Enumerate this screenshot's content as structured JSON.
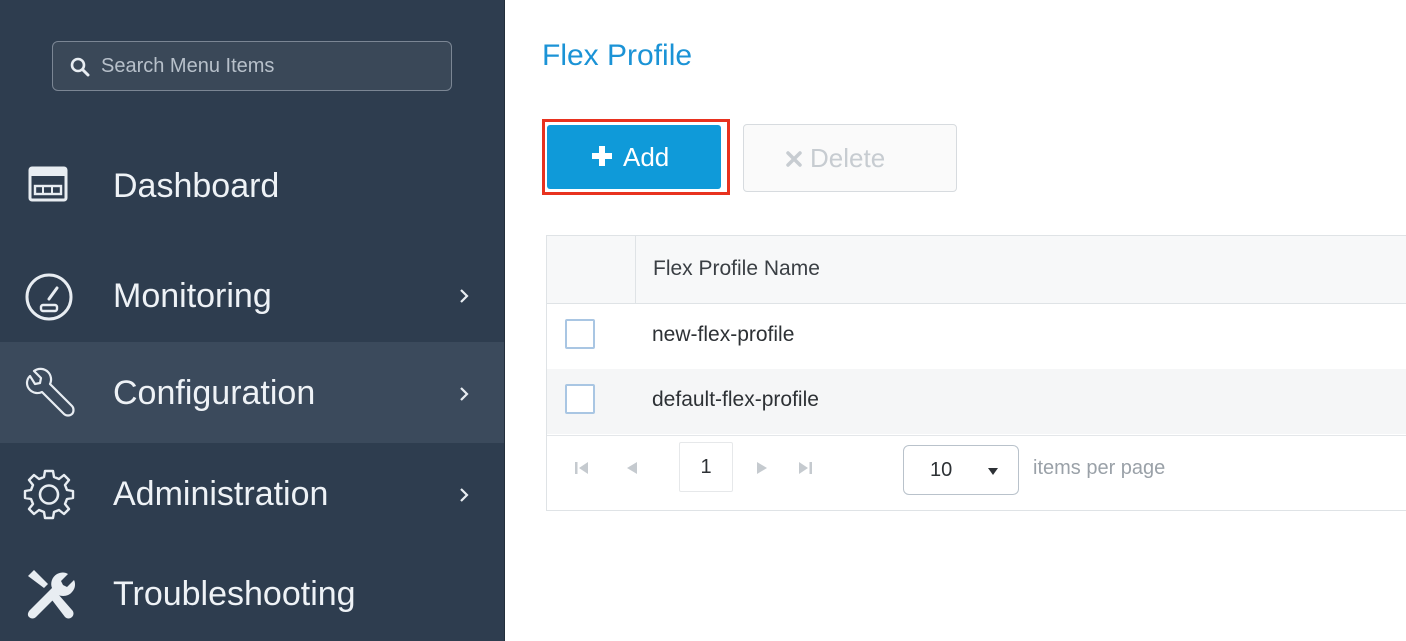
{
  "sidebar": {
    "search": {
      "placeholder": "Search Menu Items"
    },
    "items": [
      {
        "label": "Dashboard",
        "icon": "dashboard-icon",
        "has_submenu": false,
        "active": false
      },
      {
        "label": "Monitoring",
        "icon": "gauge-icon",
        "has_submenu": true,
        "active": false
      },
      {
        "label": "Configuration",
        "icon": "wrench-icon",
        "has_submenu": true,
        "active": true
      },
      {
        "label": "Administration",
        "icon": "gear-icon",
        "has_submenu": true,
        "active": false
      },
      {
        "label": "Troubleshooting",
        "icon": "tools-icon",
        "has_submenu": false,
        "active": false
      }
    ]
  },
  "main": {
    "title": "Flex Profile",
    "toolbar": {
      "add_label": "Add",
      "delete_label": "Delete"
    },
    "table": {
      "columns": [
        "Flex Profile Name"
      ],
      "rows": [
        {
          "name": "new-flex-profile",
          "checked": false
        },
        {
          "name": "default-flex-profile",
          "checked": false
        }
      ]
    },
    "pagination": {
      "current_page": "1",
      "page_size": "10",
      "items_per_page_label": "items per page"
    }
  },
  "colors": {
    "sidebar_bg": "#2e3d4f",
    "sidebar_active_bg": "#3b4a5c",
    "accent_blue": "#0f9ad9",
    "title_blue": "#1b93d6",
    "highlight_red": "#e8321f"
  }
}
